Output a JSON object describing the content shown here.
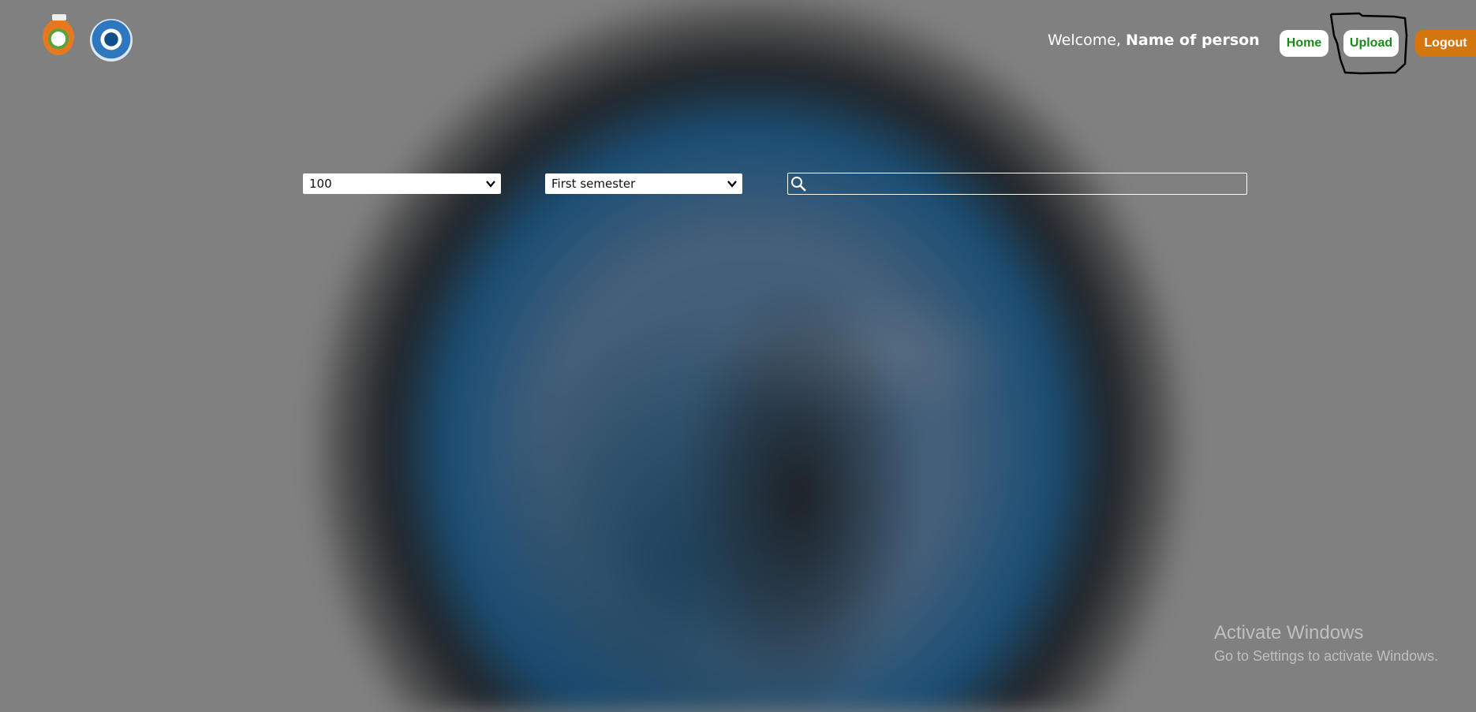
{
  "header": {
    "welcome_prefix": "Welcome,",
    "user_name": "Name of person",
    "nav": {
      "home_label": "Home",
      "upload_label": "Upload",
      "logout_label": "Logout"
    },
    "logos": [
      "school-crest-icon",
      "university-seal-icon"
    ]
  },
  "filters": {
    "level_selected": "100",
    "semester_selected": "First semester",
    "search_value": ""
  },
  "watermark": {
    "title": "Activate Windows",
    "subtitle": "Go to Settings to activate Windows."
  },
  "colors": {
    "nav_text": "#1a8a1a",
    "logout_bg": "#d4760e",
    "background": "#808080"
  }
}
